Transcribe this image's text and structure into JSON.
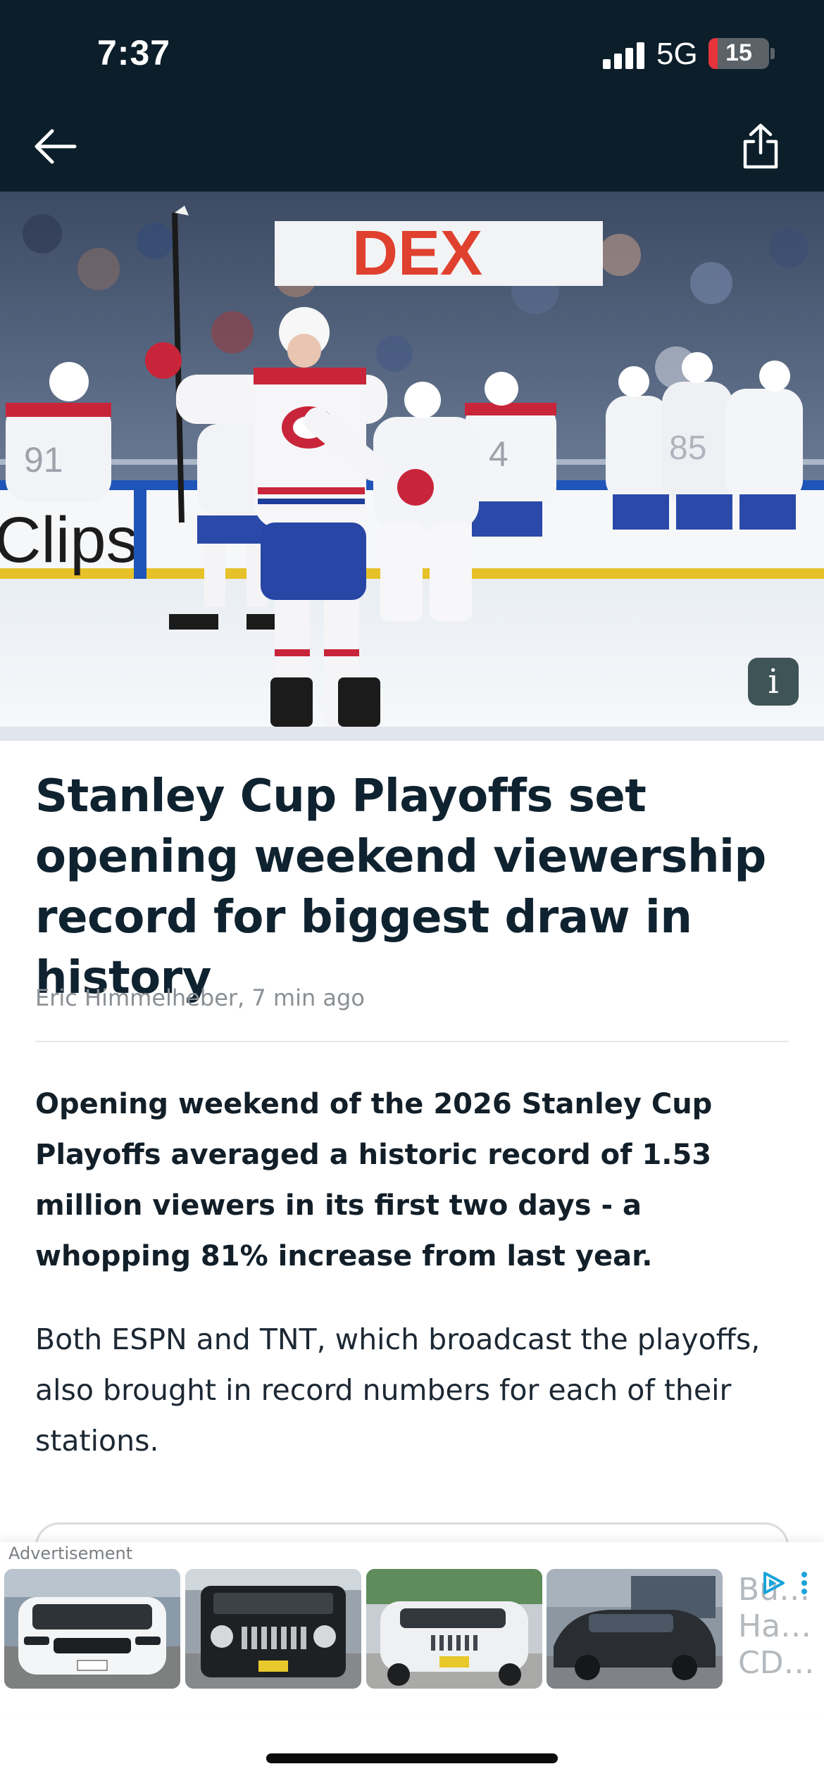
{
  "status_bar": {
    "time": "7:37",
    "network": "5G",
    "battery_level": "15",
    "battery_fraction": 0.15
  },
  "header": {
    "back_icon": "arrow-left-icon",
    "share_icon": "share-icon"
  },
  "hero": {
    "info_label": "i"
  },
  "article": {
    "headline": "Stanley Cup Playoffs set opening weekend viewership record for biggest draw in history",
    "byline": "Eric Himmelheber, 7 min ago",
    "lede": "Opening weekend of the 2026 Stanley Cup Playoffs averaged a historic record of 1.53 million viewers in its first two days - a whopping 81% increase from last year.",
    "paragraph": "Both ESPN and TNT, which broadcast the playoffs, also brought in record numbers for each of their stations."
  },
  "ad": {
    "label": "Advertisement",
    "truncated_text": "Bu…\nHa…\nCD…",
    "vehicles": [
      {
        "name": "white-suv",
        "body_color": "#f4f5f6"
      },
      {
        "name": "black-jeep-wrangler",
        "body_color": "#1e2124"
      },
      {
        "name": "white-jeep-cherokee",
        "body_color": "#eef0f2"
      },
      {
        "name": "dark-jeep-compass",
        "body_color": "#2a2e33"
      }
    ]
  },
  "colors": {
    "header_bg": "#0b1e2a",
    "headline": "#0f2230",
    "battery_red": "#e5343c"
  }
}
